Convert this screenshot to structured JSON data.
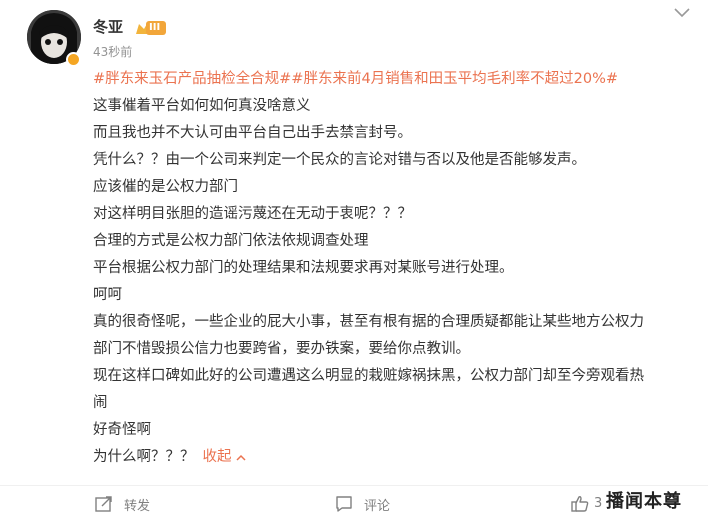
{
  "post": {
    "author": "冬亚",
    "vip_level": "III",
    "time": "43秒前",
    "hashtags": "#胖东来玉石产品抽检全合规##胖东来前4月销售和田玉平均毛利率不超过20%#",
    "lines": [
      "这事催着平台如何如何真没啥意义",
      "而且我也并不大认可由平台自己出手去禁言封号。",
      "凭什么？？由一个公司来判定一个民众的言论对错与否以及他是否能够发声。",
      "应该催的是公权力部门",
      "对这样明目张胆的造谣污蔑还在无动于衷呢？？？",
      "合理的方式是公权力部门依法依规调查处理",
      "平台根据公权力部门的处理结果和法规要求再对某账号进行处理。",
      "呵呵",
      "真的很奇怪呢，一些企业的屁大小事，甚至有根有据的合理质疑都能让某些地方公权力",
      "部门不惜毁损公信力也要跨省，要办铁案，要给你点教训。",
      "现在这样口碑如此好的公司遭遇这么明显的栽赃嫁祸抹黑，公权力部门却至今旁观看热",
      "闹",
      "好奇怪啊",
      "为什么啊？？？"
    ],
    "collapse_label": "收起"
  },
  "actions": {
    "repost_label": "转发",
    "comment_label": "评论",
    "like_count": "3"
  },
  "watermark": "播闻本尊",
  "colors": {
    "accent": "#eb7350",
    "badge": "#f5a623"
  },
  "icons": [
    "chevron-down-icon",
    "repost-icon",
    "comment-icon",
    "like-icon",
    "vip-crown-icon"
  ]
}
